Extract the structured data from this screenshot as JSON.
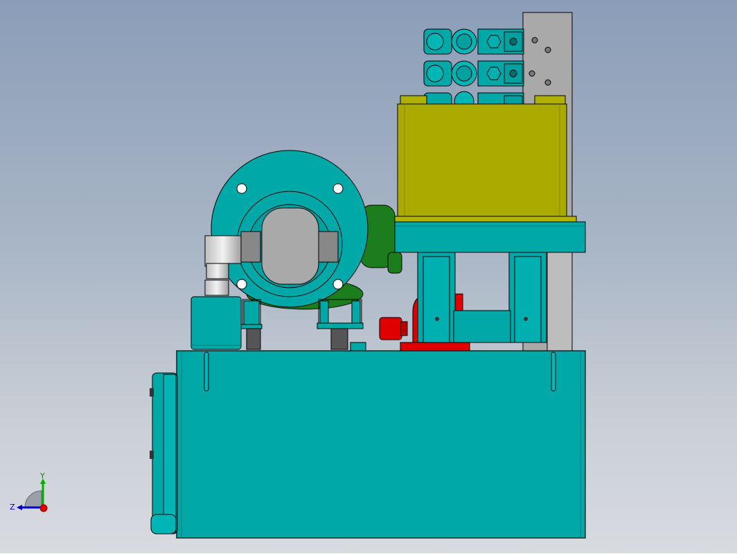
{
  "viewport": {
    "background_top": "#8b9db8",
    "background_bottom": "#d8dbe0"
  },
  "colors": {
    "teal": "#00a8a8",
    "teal_dark": "#007a7a",
    "yellow": "#aaaa00",
    "green": "#1b7d1b",
    "red": "#e00000",
    "grey": "#a9a9a9",
    "steel": "#c8c8c8"
  },
  "triad": {
    "y_label": "Y",
    "z_label": "Z",
    "x_color": "#e00000",
    "y_color": "#00b000",
    "z_color": "#0000d0"
  }
}
